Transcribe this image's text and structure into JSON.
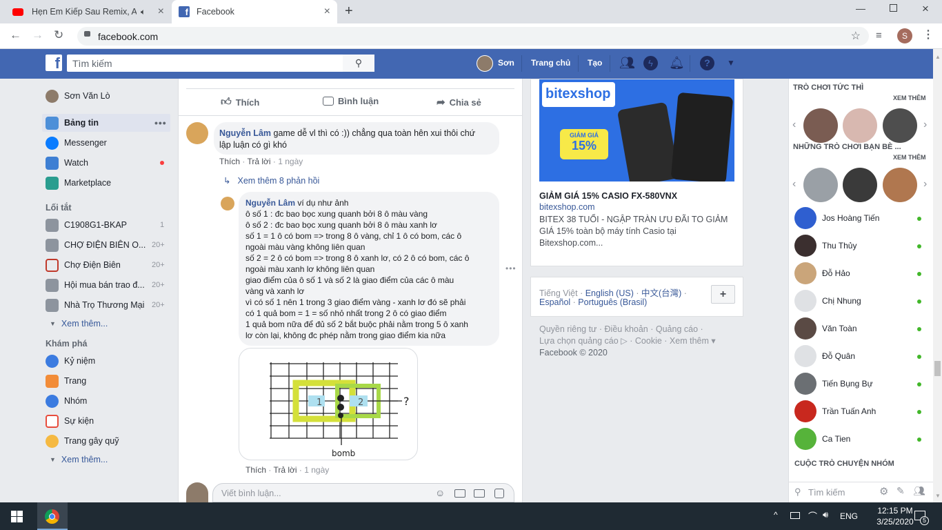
{
  "browser": {
    "tabs": [
      {
        "title": "Hẹn Em Kiếp Sau Remix, Anh"
      },
      {
        "title": "Facebook"
      }
    ],
    "url": "facebook.com",
    "profile_initial": "S"
  },
  "fb": {
    "search_placeholder": "Tìm kiếm",
    "nav": {
      "user": "Sơn",
      "home": "Trang chủ",
      "create": "Tạo"
    }
  },
  "left": {
    "user": "Sơn Văn Lò",
    "main": [
      {
        "label": "Bảng tin",
        "icon": "news-feed-icon"
      },
      {
        "label": "Messenger",
        "icon": "messenger-icon"
      },
      {
        "label": "Watch",
        "icon": "watch-icon"
      },
      {
        "label": "Marketplace",
        "icon": "marketplace-icon"
      }
    ],
    "shortcuts_title": "Lối tắt",
    "shortcuts": [
      {
        "label": "C1908G1-BKAP",
        "count": "1"
      },
      {
        "label": "CHỢ ĐIỆN BIÊN O...",
        "count": "20+"
      },
      {
        "label": "Chợ Điện Biên",
        "count": "20+"
      },
      {
        "label": "Hội mua bán trao đ...",
        "count": "20+"
      },
      {
        "label": "Nhà Trọ Thương Mại",
        "count": "20+"
      }
    ],
    "see_more": "Xem thêm...",
    "explore_title": "Khám phá",
    "explore": [
      {
        "label": "Kỷ niệm",
        "icon": "memories-icon"
      },
      {
        "label": "Trang",
        "icon": "pages-flag-icon"
      },
      {
        "label": "Nhóm",
        "icon": "groups-icon"
      },
      {
        "label": "Sự kiện",
        "icon": "calendar-icon"
      },
      {
        "label": "Trang gây quỹ",
        "icon": "fundraiser-icon"
      }
    ]
  },
  "post": {
    "actions": {
      "like": "Thích",
      "comment": "Bình luận",
      "share": "Chia sẻ"
    },
    "comment1": {
      "name": "Nguyễn Lâm",
      "text1": "game dễ vl thì có :)) chẳng qua toàn hên xui thôi chứ",
      "text2": "lập luận có gì khó",
      "like": "Thích",
      "reply": "Trả lời",
      "time": "1 ngày"
    },
    "more_replies": "Xem thêm 8 phản hồi",
    "reply": {
      "name": "Nguyễn Lâm",
      "lines": [
        "ví dụ như ảnh",
        "ô số 1 : đc bao bọc xung quanh bởi 8 ô màu vàng",
        "ô số 2 : đc bao bọc xung quanh bởi 8 ô màu xanh lơ",
        "số 1 = 1 ô có bom => trong 8 ô vàng, chỉ 1 ô có bom, các ô",
        "ngoài màu vàng không liên quan",
        "số 2 = 2 ô có bom => trong 8 ô xanh lơ, có 2 ô có bom, các ô",
        "ngoài màu xanh lơ không liên quan",
        "giao điểm của ô số 1 và số 2 là giao điểm của các ô màu",
        "vàng và xanh lơ",
        "vì có số 1 nên 1 trong 3 giao điểm vàng - xanh lơ đó sẽ phải",
        "có 1 quả bom = 1 = số nhỏ nhất trong 2 ô có giao điểm",
        "1 quả bom nữa để đủ số 2 bắt buộc phải nằm trong 5 ô xanh",
        "lơ còn lại, không đc phép nằm trong giao điểm kia nữa"
      ],
      "sketch": {
        "n1": "1",
        "n2": "2",
        "q": "?",
        "bomb": "bomb"
      },
      "like": "Thích",
      "reply": "Trả lời",
      "time": "1 ngày"
    },
    "comment_placeholder": "Viết bình luận..."
  },
  "ad": {
    "brand": "bitexshop",
    "sale_badge_top": "GIẢM GIÁ",
    "sale_badge_value": "15%",
    "title": "GIẢM GIÁ 15% CASIO FX-580VNX",
    "domain": "bitexshop.com",
    "desc": "BITEX 38 TUỔI - NGẬP TRÀN ƯU ĐÃI TO GIẢM GIÁ 15% toàn bộ máy tính Casio tại Bitexshop.com..."
  },
  "languages": {
    "line1": [
      "Tiếng Việt",
      "English (US)",
      "中文(台灣)"
    ],
    "line2": [
      "Español",
      "Português (Brasil)"
    ],
    "add": "+"
  },
  "footer": {
    "line1": "Quyền riêng tư · Điều khoản · Quảng cáo ·",
    "line2": "Lựa chọn quảng cáo ▷ · Cookie · Xem thêm ▾",
    "line3": "Facebook © 2020"
  },
  "chat": {
    "instant_games": "TRÒ CHƠI TỨC THÌ",
    "see_more": "XEM THÊM",
    "friends_games": "NHỮNG TRÒ CHƠI BẠN BÈ ...",
    "contacts": [
      "Jos Hoàng Tiến",
      "Thu Thủy",
      "Đỗ Hảo",
      "Chị Nhung",
      "Văn Toàn",
      "Đỗ Quân",
      "Tiến Bụng Bự",
      "Trần Tuấn Anh",
      "Ca Tien"
    ],
    "group_chats": "CUỘC TRÒ CHUYỆN NHÓM",
    "search_placeholder": "Tìm kiếm"
  },
  "taskbar": {
    "lang": "ENG",
    "time": "12:15 PM",
    "date": "3/25/2020",
    "badge": "5"
  }
}
